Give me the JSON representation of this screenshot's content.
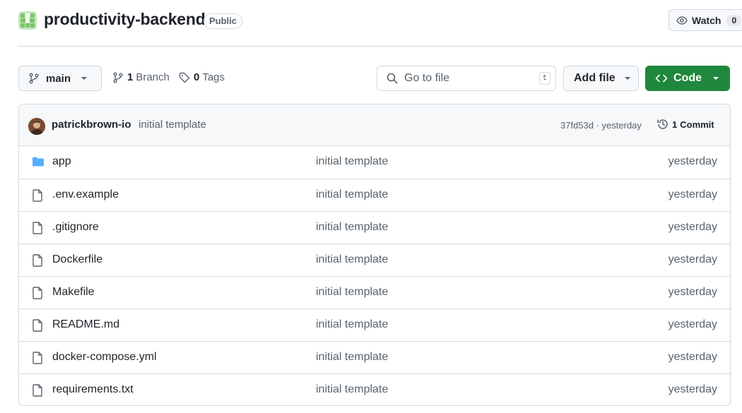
{
  "repo": {
    "name": "productivity-backend",
    "visibility": "Public",
    "watch_label": "Watch",
    "watch_count": "0"
  },
  "toolbar": {
    "branch_name": "main",
    "branches_count": "1",
    "branches_label": "Branch",
    "tags_count": "0",
    "tags_label": "Tags",
    "search_placeholder": "Go to file",
    "search_shortcut": "t",
    "add_file_label": "Add file",
    "code_label": "Code"
  },
  "latest_commit": {
    "author": "patrickbrown-io",
    "message": "initial template",
    "meta": "37fd53d · yesterday",
    "commits_count": "1",
    "commits_label": "Commit"
  },
  "files": [
    {
      "name": "app",
      "type": "folder",
      "message": "initial template",
      "date": "yesterday"
    },
    {
      "name": ".env.example",
      "type": "file",
      "message": "initial template",
      "date": "yesterday"
    },
    {
      "name": ".gitignore",
      "type": "file",
      "message": "initial template",
      "date": "yesterday"
    },
    {
      "name": "Dockerfile",
      "type": "file",
      "message": "initial template",
      "date": "yesterday"
    },
    {
      "name": "Makefile",
      "type": "file",
      "message": "initial template",
      "date": "yesterday"
    },
    {
      "name": "README.md",
      "type": "file",
      "message": "initial template",
      "date": "yesterday"
    },
    {
      "name": "docker-compose.yml",
      "type": "file",
      "message": "initial template",
      "date": "yesterday"
    },
    {
      "name": "requirements.txt",
      "type": "file",
      "message": "initial template",
      "date": "yesterday"
    }
  ],
  "colors": {
    "accent_green": "#1f883d",
    "folder_blue": "#54aeff",
    "muted_text": "#59636e",
    "border": "#d1d9e0"
  }
}
